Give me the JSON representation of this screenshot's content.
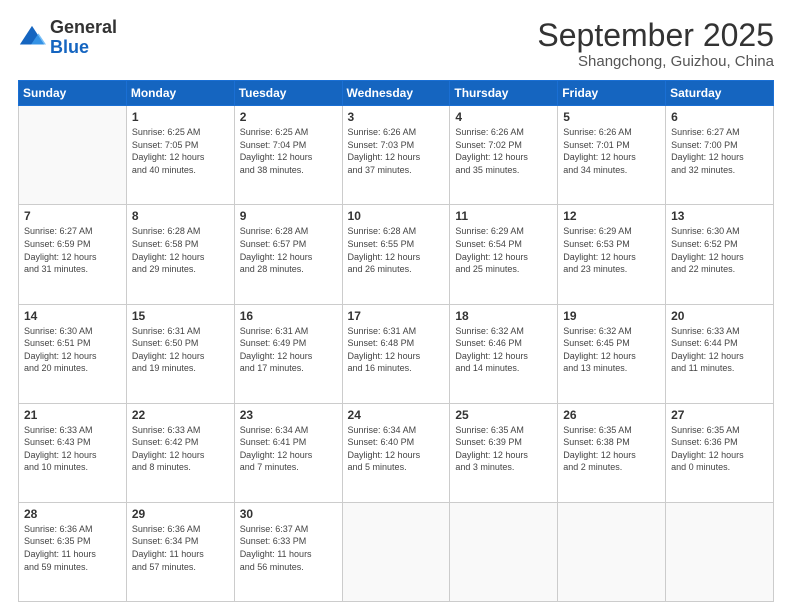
{
  "header": {
    "logo": {
      "line1": "General",
      "line2": "Blue"
    },
    "title": "September 2025",
    "subtitle": "Shangchong, Guizhou, China"
  },
  "weekdays": [
    "Sunday",
    "Monday",
    "Tuesday",
    "Wednesday",
    "Thursday",
    "Friday",
    "Saturday"
  ],
  "weeks": [
    [
      {
        "day": "",
        "info": ""
      },
      {
        "day": "1",
        "info": "Sunrise: 6:25 AM\nSunset: 7:05 PM\nDaylight: 12 hours\nand 40 minutes."
      },
      {
        "day": "2",
        "info": "Sunrise: 6:25 AM\nSunset: 7:04 PM\nDaylight: 12 hours\nand 38 minutes."
      },
      {
        "day": "3",
        "info": "Sunrise: 6:26 AM\nSunset: 7:03 PM\nDaylight: 12 hours\nand 37 minutes."
      },
      {
        "day": "4",
        "info": "Sunrise: 6:26 AM\nSunset: 7:02 PM\nDaylight: 12 hours\nand 35 minutes."
      },
      {
        "day": "5",
        "info": "Sunrise: 6:26 AM\nSunset: 7:01 PM\nDaylight: 12 hours\nand 34 minutes."
      },
      {
        "day": "6",
        "info": "Sunrise: 6:27 AM\nSunset: 7:00 PM\nDaylight: 12 hours\nand 32 minutes."
      }
    ],
    [
      {
        "day": "7",
        "info": "Sunrise: 6:27 AM\nSunset: 6:59 PM\nDaylight: 12 hours\nand 31 minutes."
      },
      {
        "day": "8",
        "info": "Sunrise: 6:28 AM\nSunset: 6:58 PM\nDaylight: 12 hours\nand 29 minutes."
      },
      {
        "day": "9",
        "info": "Sunrise: 6:28 AM\nSunset: 6:57 PM\nDaylight: 12 hours\nand 28 minutes."
      },
      {
        "day": "10",
        "info": "Sunrise: 6:28 AM\nSunset: 6:55 PM\nDaylight: 12 hours\nand 26 minutes."
      },
      {
        "day": "11",
        "info": "Sunrise: 6:29 AM\nSunset: 6:54 PM\nDaylight: 12 hours\nand 25 minutes."
      },
      {
        "day": "12",
        "info": "Sunrise: 6:29 AM\nSunset: 6:53 PM\nDaylight: 12 hours\nand 23 minutes."
      },
      {
        "day": "13",
        "info": "Sunrise: 6:30 AM\nSunset: 6:52 PM\nDaylight: 12 hours\nand 22 minutes."
      }
    ],
    [
      {
        "day": "14",
        "info": "Sunrise: 6:30 AM\nSunset: 6:51 PM\nDaylight: 12 hours\nand 20 minutes."
      },
      {
        "day": "15",
        "info": "Sunrise: 6:31 AM\nSunset: 6:50 PM\nDaylight: 12 hours\nand 19 minutes."
      },
      {
        "day": "16",
        "info": "Sunrise: 6:31 AM\nSunset: 6:49 PM\nDaylight: 12 hours\nand 17 minutes."
      },
      {
        "day": "17",
        "info": "Sunrise: 6:31 AM\nSunset: 6:48 PM\nDaylight: 12 hours\nand 16 minutes."
      },
      {
        "day": "18",
        "info": "Sunrise: 6:32 AM\nSunset: 6:46 PM\nDaylight: 12 hours\nand 14 minutes."
      },
      {
        "day": "19",
        "info": "Sunrise: 6:32 AM\nSunset: 6:45 PM\nDaylight: 12 hours\nand 13 minutes."
      },
      {
        "day": "20",
        "info": "Sunrise: 6:33 AM\nSunset: 6:44 PM\nDaylight: 12 hours\nand 11 minutes."
      }
    ],
    [
      {
        "day": "21",
        "info": "Sunrise: 6:33 AM\nSunset: 6:43 PM\nDaylight: 12 hours\nand 10 minutes."
      },
      {
        "day": "22",
        "info": "Sunrise: 6:33 AM\nSunset: 6:42 PM\nDaylight: 12 hours\nand 8 minutes."
      },
      {
        "day": "23",
        "info": "Sunrise: 6:34 AM\nSunset: 6:41 PM\nDaylight: 12 hours\nand 7 minutes."
      },
      {
        "day": "24",
        "info": "Sunrise: 6:34 AM\nSunset: 6:40 PM\nDaylight: 12 hours\nand 5 minutes."
      },
      {
        "day": "25",
        "info": "Sunrise: 6:35 AM\nSunset: 6:39 PM\nDaylight: 12 hours\nand 3 minutes."
      },
      {
        "day": "26",
        "info": "Sunrise: 6:35 AM\nSunset: 6:38 PM\nDaylight: 12 hours\nand 2 minutes."
      },
      {
        "day": "27",
        "info": "Sunrise: 6:35 AM\nSunset: 6:36 PM\nDaylight: 12 hours\nand 0 minutes."
      }
    ],
    [
      {
        "day": "28",
        "info": "Sunrise: 6:36 AM\nSunset: 6:35 PM\nDaylight: 11 hours\nand 59 minutes."
      },
      {
        "day": "29",
        "info": "Sunrise: 6:36 AM\nSunset: 6:34 PM\nDaylight: 11 hours\nand 57 minutes."
      },
      {
        "day": "30",
        "info": "Sunrise: 6:37 AM\nSunset: 6:33 PM\nDaylight: 11 hours\nand 56 minutes."
      },
      {
        "day": "",
        "info": ""
      },
      {
        "day": "",
        "info": ""
      },
      {
        "day": "",
        "info": ""
      },
      {
        "day": "",
        "info": ""
      }
    ]
  ]
}
